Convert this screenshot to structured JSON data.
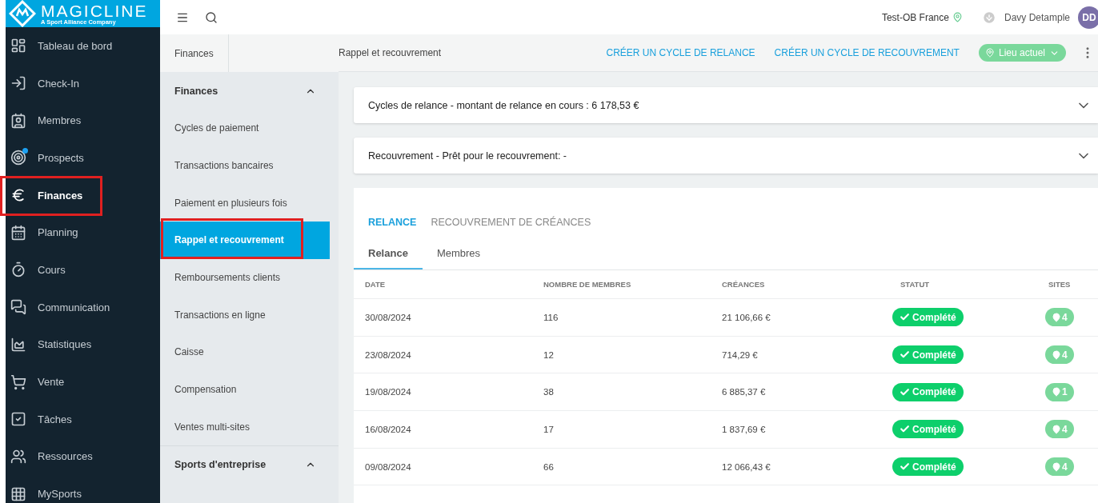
{
  "brand": {
    "name": "MAGICLINE",
    "tagline": "A Sport Alliance Company"
  },
  "topbar": {
    "location": "Test-OB France",
    "user": "Davy Detample",
    "initials": "DD"
  },
  "sidebar": {
    "items": [
      {
        "kind": "dashboard",
        "label": "Tableau de bord",
        "selected": false,
        "annotated": false,
        "badge": false
      },
      {
        "kind": "checkin",
        "label": "Check-In",
        "selected": false,
        "annotated": false,
        "badge": false
      },
      {
        "kind": "members",
        "label": "Membres",
        "selected": false,
        "annotated": false,
        "badge": false
      },
      {
        "kind": "prospects",
        "label": "Prospects",
        "selected": false,
        "annotated": false,
        "badge": true
      },
      {
        "kind": "finance",
        "label": "Finances",
        "selected": true,
        "annotated": true,
        "badge": false
      },
      {
        "kind": "calendar",
        "label": "Planning",
        "selected": false,
        "annotated": false,
        "badge": false
      },
      {
        "kind": "timer",
        "label": "Cours",
        "selected": false,
        "annotated": false,
        "badge": false
      },
      {
        "kind": "chat",
        "label": "Communication",
        "selected": false,
        "annotated": false,
        "badge": false
      },
      {
        "kind": "chart",
        "label": "Statistiques",
        "selected": false,
        "annotated": false,
        "badge": false
      },
      {
        "kind": "cart",
        "label": "Vente",
        "selected": false,
        "annotated": false,
        "badge": false
      },
      {
        "kind": "task",
        "label": "Tâches",
        "selected": false,
        "annotated": false,
        "badge": false
      },
      {
        "kind": "users",
        "label": "Ressources",
        "selected": false,
        "annotated": false,
        "badge": false
      },
      {
        "kind": "grid",
        "label": "MySports",
        "selected": false,
        "annotated": false,
        "badge": false
      }
    ]
  },
  "breadcrumb": [
    "Finances",
    "Rappel et recouvrement"
  ],
  "actions": [
    "CRÉER UN CYCLE DE RELANCE",
    "CRÉER UN CYCLE DE RECOUVREMENT"
  ],
  "location_button": "Lieu actuel",
  "subnav": {
    "sections": [
      {
        "title": "Finances",
        "expanded": true,
        "items": [
          {
            "label": "Cycles de paiement",
            "selected": false,
            "annotated": false
          },
          {
            "label": "Transactions bancaires",
            "selected": false,
            "annotated": false
          },
          {
            "label": "Paiement en plusieurs fois",
            "selected": false,
            "annotated": false
          },
          {
            "label": "Rappel et recouvrement",
            "selected": true,
            "annotated": true
          },
          {
            "label": "Remboursements clients",
            "selected": false,
            "annotated": false
          },
          {
            "label": "Transactions en ligne",
            "selected": false,
            "annotated": false
          },
          {
            "label": "Caisse",
            "selected": false,
            "annotated": false
          },
          {
            "label": "Compensation",
            "selected": false,
            "annotated": false
          },
          {
            "label": "Ventes multi-sites",
            "selected": false,
            "annotated": false
          }
        ]
      },
      {
        "title": "Sports d'entreprise",
        "expanded": true
      }
    ]
  },
  "panels": [
    {
      "title": "Cycles de relance - montant de relance en cours : 6 178,53 €",
      "expanded": false
    },
    {
      "title": "Recouvrement - Prêt pour le recouvrement: -",
      "expanded": false
    }
  ],
  "tabs": [
    {
      "label": "RELANCE",
      "selected": true
    },
    {
      "label": "RECOUVREMENT DE CRÉANCES",
      "selected": false
    }
  ],
  "subtabs": [
    {
      "label": "Relance",
      "selected": true
    },
    {
      "label": "Membres",
      "selected": false
    }
  ],
  "table": {
    "columns": [
      "DATE",
      "NOMBRE DE MEMBRES",
      "CRÉANCES",
      "STATUT",
      "SITES"
    ],
    "rows": [
      {
        "date": "30/08/2024",
        "members": "116",
        "amount": "21 106,66 €",
        "status": "Complété",
        "sites": "4"
      },
      {
        "date": "23/08/2024",
        "members": "12",
        "amount": "714,29 €",
        "status": "Complété",
        "sites": "4"
      },
      {
        "date": "19/08/2024",
        "members": "38",
        "amount": "6 885,37 €",
        "status": "Complété",
        "sites": "1"
      },
      {
        "date": "16/08/2024",
        "members": "17",
        "amount": "1 837,69 €",
        "status": "Complété",
        "sites": "4"
      },
      {
        "date": "09/08/2024",
        "members": "66",
        "amount": "12 066,43 €",
        "status": "Complété",
        "sites": "4"
      }
    ]
  }
}
